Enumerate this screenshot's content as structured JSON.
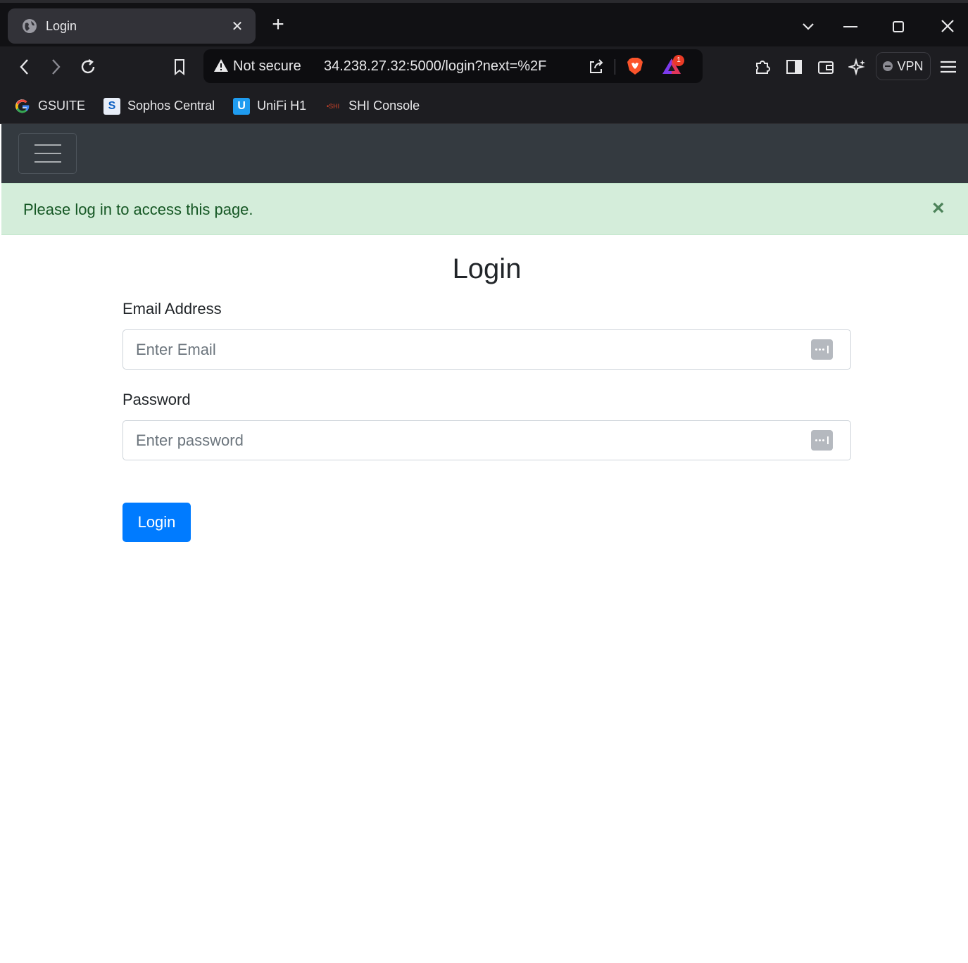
{
  "browser": {
    "tab": {
      "title": "Login",
      "close_glyph": "✕"
    },
    "new_tab_glyph": "+",
    "omnibox": {
      "security_label": "Not secure",
      "url": "34.238.27.32:5000/login?next=%2F",
      "rewards_badge": "1"
    },
    "vpn_label": "VPN",
    "bookmarks": [
      {
        "label": "GSUITE",
        "icon": "google-icon"
      },
      {
        "label": "Sophos Central",
        "icon": "sophos-icon"
      },
      {
        "label": "UniFi H1",
        "icon": "unifi-icon"
      },
      {
        "label": "SHI Console",
        "icon": "shi-icon"
      }
    ]
  },
  "page": {
    "alert": {
      "message": "Please log in to access this page.",
      "close_glyph": "×"
    },
    "title": "Login",
    "form": {
      "email_label": "Email Address",
      "email_placeholder": "Enter Email",
      "email_value": "",
      "password_label": "Password",
      "password_placeholder": "Enter password",
      "password_value": "",
      "submit_label": "Login"
    }
  },
  "colors": {
    "navbar": "#343a40",
    "alert_bg": "#d4edda",
    "alert_text": "#155724",
    "primary": "#007bff"
  }
}
